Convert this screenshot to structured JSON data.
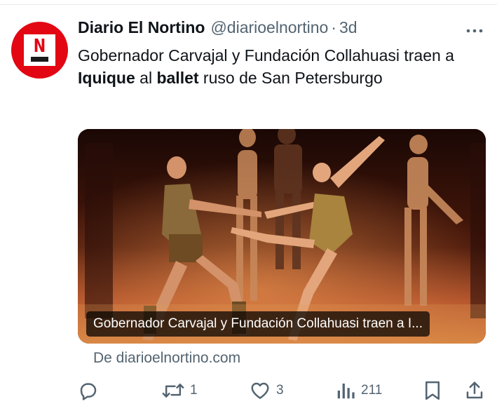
{
  "tweet": {
    "author_name": "Diario El Nortino",
    "handle": "@diarioelnortino",
    "separator": "·",
    "time": "3d",
    "text_parts": [
      "Gobernador Carvajal y Fundación Collahuasi traen a ",
      "Iquique",
      " al ",
      "ballet",
      " ruso de San Petersburgo"
    ]
  },
  "avatar": {
    "letter": "N",
    "bg_color": "#e30613"
  },
  "card": {
    "caption": "Gobernador Carvajal y Fundación Collahuasi traen a I...",
    "image_alt": "ballet-dancers-photo",
    "source": "De diarioelnortino.com"
  },
  "actions": {
    "reply": {
      "icon": "reply-icon",
      "count": ""
    },
    "retweet": {
      "icon": "retweet-icon",
      "count": "1"
    },
    "like": {
      "icon": "heart-icon",
      "count": "3"
    },
    "views": {
      "icon": "views-icon",
      "count": "211"
    },
    "bookmark": {
      "icon": "bookmark-icon"
    },
    "share": {
      "icon": "share-icon"
    }
  },
  "colors": {
    "text": "#0f1419",
    "secondary": "#536471",
    "brand": "#e30613"
  }
}
